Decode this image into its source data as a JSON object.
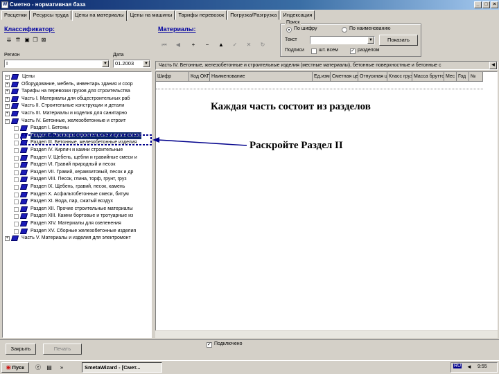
{
  "window": {
    "title": "Сметно - нормативная база",
    "app_icon": "W"
  },
  "tabs": [
    {
      "label": "Расценки"
    },
    {
      "label": "Ресурсы труда"
    },
    {
      "label": "Цены на материалы"
    },
    {
      "label": "Цены на машины"
    },
    {
      "label": "Тарифы перевозок"
    },
    {
      "label": "Погрузка/Разгрузка"
    },
    {
      "label": "Индексация"
    }
  ],
  "left": {
    "title": "Классификатор:",
    "region_label": "Регион",
    "region_value": "I",
    "date_label": "Дата",
    "date_value": "01.2003"
  },
  "tree": {
    "root": "Цены",
    "nodes": [
      {
        "label": "Оборудование, мебель, инвентарь здания и соор"
      },
      {
        "label": "Тарифы на перевозки грузов для строительства"
      },
      {
        "label": "Часть I. Материалы для общестроительных раб"
      },
      {
        "label": "Часть II. Строительные конструкции и детали"
      },
      {
        "label": "Часть III. Материалы и изделия для санитарно"
      },
      {
        "label": "Часть IV. Бетонные, железобетонные и строит"
      },
      {
        "label": "Раздел I. Бетоны"
      },
      {
        "label": "Раздел II. Растворы строительные и сухие смеси"
      },
      {
        "label": "Раздел III. Бетонные, железобетонные изделия"
      },
      {
        "label": "Раздел IV. Кирпич и камни строительные"
      },
      {
        "label": "Раздел V. Щебень, щебни и гравийные смеси и"
      },
      {
        "label": "Раздел VI. Гравий природный и песок"
      },
      {
        "label": "Раздел VII. Гравий, керамзитовый, песок и др"
      },
      {
        "label": "Раздел VIII. Песок, глина, торф, грунт, груз"
      },
      {
        "label": "Раздел IX. Щебень, гравий, песок, камень"
      },
      {
        "label": "Раздел X. Асфальтобетонные смеси, битум"
      },
      {
        "label": "Раздел XI. Вода, пар, сжатый воздух"
      },
      {
        "label": "Раздел XII. Прочие строительные материалы"
      },
      {
        "label": "Раздел XIII. Камни бортовые и тротуарные из"
      },
      {
        "label": "Раздел XIV. Материалы для озеленения"
      },
      {
        "label": "Раздел XV. Сборные железобетонные изделия"
      },
      {
        "label": "Часть V. Материалы и изделия для электромонт"
      }
    ]
  },
  "right": {
    "title": "Материалы:",
    "search_group": "Поиск",
    "radio_code": "По шифру",
    "radio_name": "По наименованию",
    "text_label": "Текст",
    "find_button": "Показать",
    "groups_label": "Подписи",
    "check_all": "шт. всем",
    "check_section": "разделом",
    "breadcrumb": "Часть IV. Бетонные, железобетонные и строительные изделия (местные материалы), бетонные поверхностные и бетонные с"
  },
  "grid": {
    "columns": [
      "Шифр",
      "Код ОКП",
      "Наименование",
      "Ед.изм",
      "Сметная цена",
      "Отпускная цена",
      "Класс груза",
      "Масса брутто",
      "Мес",
      "Год",
      "№"
    ]
  },
  "bottom": {
    "close_button": "Закрыть",
    "print_button": "Печать",
    "checkbox_label": "Подключено"
  },
  "annotations": {
    "line1": "Каждая часть состоит из разделов",
    "line2": "Раскройте Раздел II"
  },
  "taskbar": {
    "start": "Пуск",
    "task": "SmetaWizard - [Смет...",
    "lang": "RU",
    "time": "9:55"
  }
}
